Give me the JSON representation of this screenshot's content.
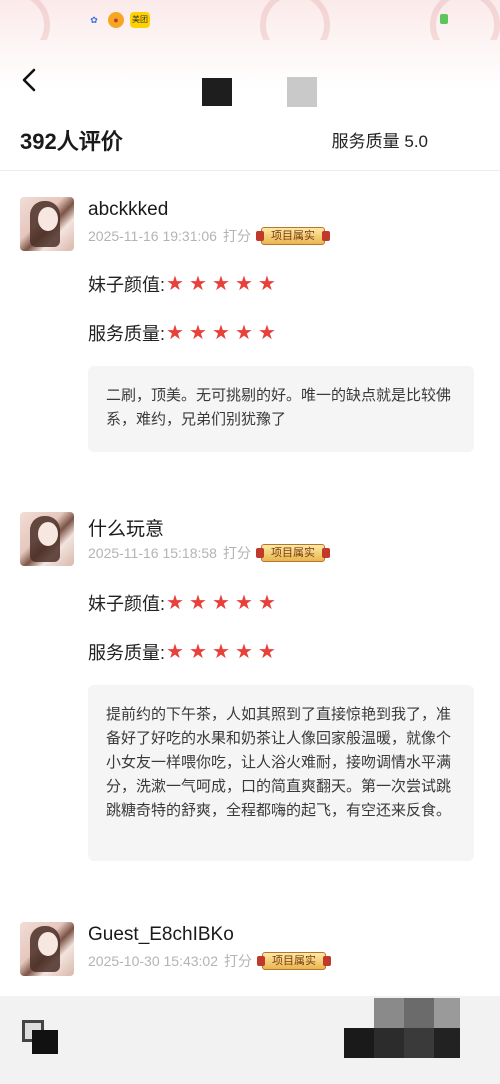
{
  "status_bar": {
    "icons": [
      "baidu-icon",
      "weibo-icon",
      "meituan-icon"
    ],
    "meituan_label": "美团"
  },
  "header": {
    "review_count": "392人评价",
    "service_quality": "服务质量 5.0"
  },
  "reviews": [
    {
      "username": "abckkked",
      "timestamp": "2025-11-16 19:31:06",
      "rated_label": "打分",
      "badge": "项目属实",
      "ratings": [
        {
          "label": "妹子颜值:",
          "stars": 5
        },
        {
          "label": "服务质量:",
          "stars": 5
        }
      ],
      "comment": "二刷，顶美。无可挑剔的好。唯一的缺点就是比较佛系，难约，兄弟们别犹豫了"
    },
    {
      "username": "什么玩意",
      "timestamp": "2025-11-16 15:18:58",
      "rated_label": "打分",
      "badge": "项目属实",
      "ratings": [
        {
          "label": "妹子颜值:",
          "stars": 5
        },
        {
          "label": "服务质量:",
          "stars": 5
        }
      ],
      "comment": "提前约的下午茶，人如其照到了直接惊艳到我了，准备好了好吃的水果和奶茶让人像回家般温暖，就像个小女友一样喂你吃，让人浴火难耐，接吻调情水平满分，洗漱一气呵成，口的简直爽翻天。第一次尝试跳跳糖奇特的舒爽，全程都嗨的起飞，有空还来反食。"
    },
    {
      "username": "Guest_E8chIBKo",
      "timestamp": "2025-10-30 15:43:02",
      "rated_label": "打分",
      "badge": "项目属实"
    }
  ],
  "colors": {
    "star": "#e8403b",
    "timestamp": "#b4b4b4",
    "comment_bg": "#f5f5f5"
  }
}
